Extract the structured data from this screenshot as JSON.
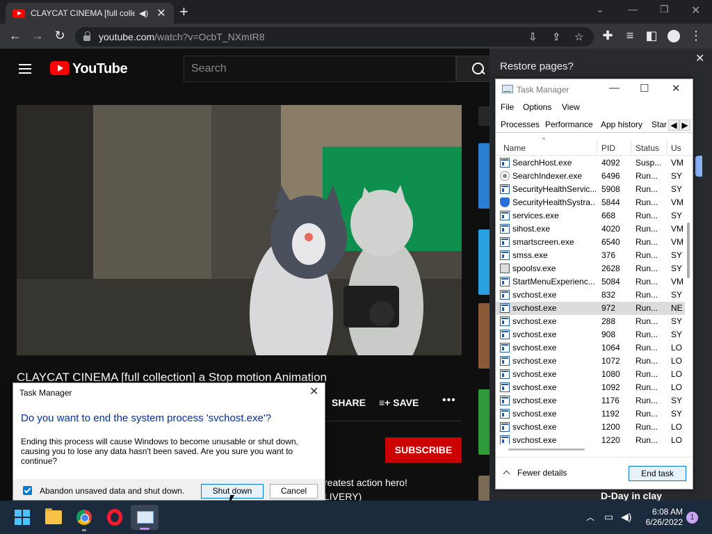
{
  "browser": {
    "tab_title": "CLAYCAT CINEMA [full collection] a Stop motion Animation",
    "new_tab_label": "+",
    "url_domain": "youtube.com",
    "url_path": "/watch?v=OcbT_NXmIR8"
  },
  "youtube": {
    "logo_text": "YouTube",
    "search_placeholder": "Search",
    "video_title": "CLAYCAT CINEMA [full collection] a Stop motion Animation",
    "share_label": "SHARE",
    "save_label": "SAVE",
    "more_label": "•••",
    "subscribe_label": "SUBSCRIBE",
    "description_line1": "reatest action hero!",
    "description_line2": "LIVERY)",
    "recommendation_title": "D-Day in clay"
  },
  "restore_bubble": {
    "title": "Restore pages?"
  },
  "task_manager": {
    "title": "Task Manager",
    "menu": [
      "File",
      "Options",
      "View"
    ],
    "tabs": [
      "Processes",
      "Performance",
      "App history",
      "Star"
    ],
    "columns": [
      "Name",
      "PID",
      "Status",
      "Us"
    ],
    "rows": [
      {
        "icon": "window",
        "name": "SearchHost.exe",
        "pid": "4092",
        "status": "Susp...",
        "user": "VM"
      },
      {
        "icon": "search",
        "name": "SearchIndexer.exe",
        "pid": "6496",
        "status": "Run...",
        "user": "SY"
      },
      {
        "icon": "window",
        "name": "SecurityHealthServic...",
        "pid": "5908",
        "status": "Run...",
        "user": "SY"
      },
      {
        "icon": "shield",
        "name": "SecurityHealthSystra...",
        "pid": "5844",
        "status": "Run...",
        "user": "VM"
      },
      {
        "icon": "window",
        "name": "services.exe",
        "pid": "668",
        "status": "Run...",
        "user": "SY"
      },
      {
        "icon": "window",
        "name": "sihost.exe",
        "pid": "4020",
        "status": "Run...",
        "user": "VM"
      },
      {
        "icon": "window",
        "name": "smartscreen.exe",
        "pid": "6540",
        "status": "Run...",
        "user": "VM"
      },
      {
        "icon": "window",
        "name": "smss.exe",
        "pid": "376",
        "status": "Run...",
        "user": "SY"
      },
      {
        "icon": "printer",
        "name": "spoolsv.exe",
        "pid": "2628",
        "status": "Run...",
        "user": "SY"
      },
      {
        "icon": "window",
        "name": "StartMenuExperienc...",
        "pid": "5084",
        "status": "Run...",
        "user": "VM"
      },
      {
        "icon": "window",
        "name": "svchost.exe",
        "pid": "832",
        "status": "Run...",
        "user": "SY"
      },
      {
        "icon": "window",
        "name": "svchost.exe",
        "pid": "972",
        "status": "Run...",
        "user": "NE",
        "selected": true
      },
      {
        "icon": "window",
        "name": "svchost.exe",
        "pid": "288",
        "status": "Run...",
        "user": "SY"
      },
      {
        "icon": "window",
        "name": "svchost.exe",
        "pid": "908",
        "status": "Run...",
        "user": "SY"
      },
      {
        "icon": "window",
        "name": "svchost.exe",
        "pid": "1064",
        "status": "Run...",
        "user": "LO"
      },
      {
        "icon": "window",
        "name": "svchost.exe",
        "pid": "1072",
        "status": "Run...",
        "user": "LO"
      },
      {
        "icon": "window",
        "name": "svchost.exe",
        "pid": "1080",
        "status": "Run...",
        "user": "LO"
      },
      {
        "icon": "window",
        "name": "svchost.exe",
        "pid": "1092",
        "status": "Run...",
        "user": "LO"
      },
      {
        "icon": "window",
        "name": "svchost.exe",
        "pid": "1176",
        "status": "Run...",
        "user": "SY"
      },
      {
        "icon": "window",
        "name": "svchost.exe",
        "pid": "1192",
        "status": "Run...",
        "user": "SY"
      },
      {
        "icon": "window",
        "name": "svchost.exe",
        "pid": "1200",
        "status": "Run...",
        "user": "LO"
      },
      {
        "icon": "window",
        "name": "svchost.exe",
        "pid": "1220",
        "status": "Run...",
        "user": "LO"
      }
    ],
    "fewer_details_label": "Fewer details",
    "end_task_label": "End task"
  },
  "dialog": {
    "title": "Task Manager",
    "question": "Do you want to end the system process 'svchost.exe'?",
    "message": "Ending this process will cause Windows to become unusable or shut down, causing you to lose any data hasn't been saved. Are you sure you want to continue?",
    "checkbox_label": "Abandon unsaved data and shut down.",
    "checkbox_checked": true,
    "shutdown_label": "Shut down",
    "cancel_label": "Cancel"
  },
  "taskbar": {
    "time": "6:08 AM",
    "date": "6/26/2022",
    "notification_count": "1"
  },
  "colors": {
    "youtube_red": "#ff0000",
    "subscribe_red": "#cc0000",
    "dialog_question_blue": "#003399",
    "windows_accent": "#0078d7"
  }
}
